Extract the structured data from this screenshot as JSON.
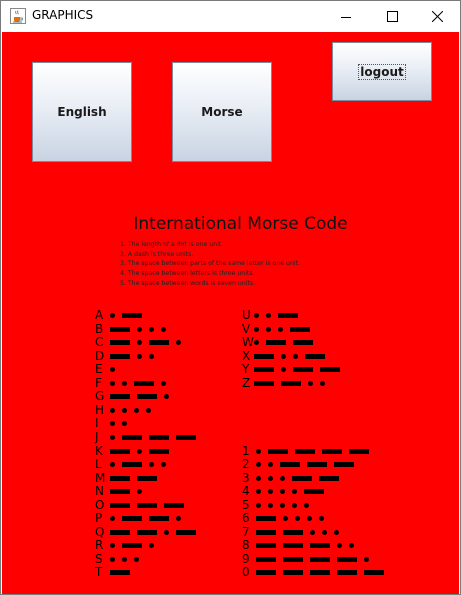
{
  "window": {
    "title": "GRAPHICS",
    "icon": "java-cup-icon",
    "controls": [
      "minimize-icon",
      "maximize-icon",
      "close-icon"
    ]
  },
  "buttons": {
    "english": "English",
    "morse": "Morse",
    "logout": "logout"
  },
  "colors": {
    "background": "#ff0000",
    "button_top": "#ffffff",
    "button_bottom": "#c8d3e2"
  },
  "heading": "International Morse Code",
  "rules": [
    "1. The length of a dot is one unit.",
    "2. A dash is three units.",
    "3. The space between parts of the same letter is one unit.",
    "4. The space between letters is three units.",
    "5. The space between words is seven units."
  ],
  "codes": [
    {
      "ch": "A",
      "code": ".-"
    },
    {
      "ch": "B",
      "code": "-..."
    },
    {
      "ch": "C",
      "code": "-.-."
    },
    {
      "ch": "D",
      "code": "-.."
    },
    {
      "ch": "E",
      "code": "."
    },
    {
      "ch": "F",
      "code": "..-."
    },
    {
      "ch": "G",
      "code": "--."
    },
    {
      "ch": "H",
      "code": "...."
    },
    {
      "ch": "I",
      "code": ".."
    },
    {
      "ch": "J",
      "code": ".---"
    },
    {
      "ch": "K",
      "code": "-.-"
    },
    {
      "ch": "L",
      "code": ".-.."
    },
    {
      "ch": "M",
      "code": "--"
    },
    {
      "ch": "N",
      "code": "-."
    },
    {
      "ch": "O",
      "code": "---"
    },
    {
      "ch": "P",
      "code": ".--."
    },
    {
      "ch": "Q",
      "code": "--.-"
    },
    {
      "ch": "R",
      "code": ".-."
    },
    {
      "ch": "S",
      "code": "..."
    },
    {
      "ch": "T",
      "code": "-"
    },
    {
      "ch": "U",
      "code": "..-"
    },
    {
      "ch": "V",
      "code": "...-"
    },
    {
      "ch": "W",
      "code": ".--"
    },
    {
      "ch": "X",
      "code": "-..-"
    },
    {
      "ch": "Y",
      "code": "-.--"
    },
    {
      "ch": "Z",
      "code": "--.."
    },
    {
      "ch": "1",
      "code": ".----"
    },
    {
      "ch": "2",
      "code": "..---"
    },
    {
      "ch": "3",
      "code": "...--"
    },
    {
      "ch": "4",
      "code": "....-"
    },
    {
      "ch": "5",
      "code": "....."
    },
    {
      "ch": "6",
      "code": "-...."
    },
    {
      "ch": "7",
      "code": "--..."
    },
    {
      "ch": "8",
      "code": "---.."
    },
    {
      "ch": "9",
      "code": "----."
    },
    {
      "ch": "0",
      "code": "-----"
    }
  ]
}
